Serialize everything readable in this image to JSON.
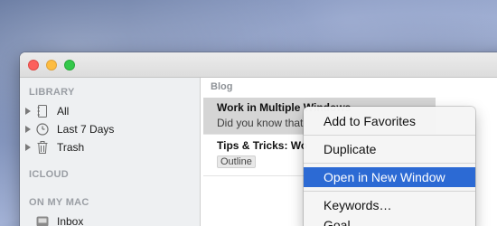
{
  "sidebar": {
    "library_label": "LIBRARY",
    "items": [
      {
        "label": "All",
        "icon": "notebook-icon"
      },
      {
        "label": "Last 7 Days",
        "icon": "clock-icon"
      },
      {
        "label": "Trash",
        "icon": "trash-icon"
      }
    ],
    "icloud_label": "ICLOUD",
    "on_my_mac_label": "ON MY MAC",
    "mac_items": [
      {
        "label": "Inbox",
        "icon": "inbox-icon"
      }
    ]
  },
  "list": {
    "header": "Blog",
    "notes": [
      {
        "title": "Work in Multiple Windows",
        "snippet": "Did you know that",
        "selected": true
      },
      {
        "title": "Tips & Tricks: Wo",
        "tag": "Outline",
        "selected": false
      }
    ]
  },
  "context_menu": {
    "items": [
      {
        "label": "Add to Favorites"
      },
      {
        "label": "Duplicate"
      },
      {
        "label": "Open in New Window",
        "highlighted": true
      },
      {
        "label": "Keywords…"
      },
      {
        "label": "Goal…"
      }
    ]
  },
  "colors": {
    "highlight": "#2c6ad4",
    "selected_row": "#d5d5d5",
    "sidebar_bg": "#eef0f2"
  }
}
